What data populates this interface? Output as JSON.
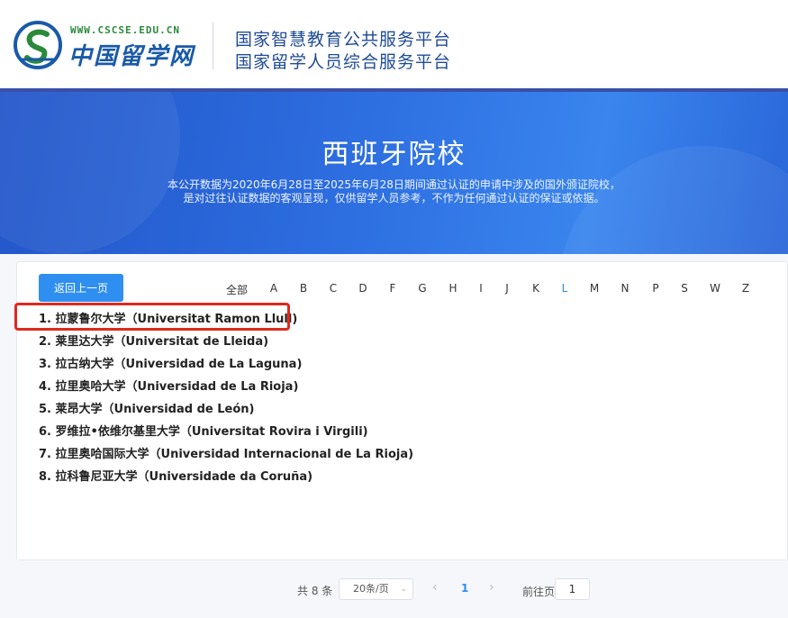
{
  "header": {
    "logo_url": "WWW.CSCSE.EDU.CN",
    "logo_name": "中国留学网",
    "platform_line1": "国家智慧教育公共服务平台",
    "platform_line2": "国家留学人员综合服务平台"
  },
  "banner": {
    "title": "西班牙院校",
    "desc_line1": "本公开数据为2020年6月28日至2025年6月28日期间通过认证的申请中涉及的国外颁证院校，",
    "desc_line2": "是对过往认证数据的客观呈现，仅供留学人员参考，不作为任何通过认证的保证或依据。"
  },
  "toolbar": {
    "back_label": "返回上一页"
  },
  "letters": [
    "全部",
    "A",
    "B",
    "C",
    "D",
    "F",
    "G",
    "H",
    "I",
    "J",
    "K",
    "L",
    "M",
    "N",
    "P",
    "S",
    "W",
    "Z"
  ],
  "active_letter": "L",
  "schools": [
    "1. 拉蒙鲁尔大学（Universitat Ramon Llull)",
    "2. 莱里达大学（Universitat de Lleida)",
    "3. 拉古纳大学（Universidad de La Laguna)",
    "4. 拉里奥哈大学（Universidad de La Rioja)",
    "5. 莱昂大学（Universidad de León)",
    "6. 罗维拉•依维尔基里大学（Universitat Rovira i Virgili)",
    "7. 拉里奥哈国际大学（Universidad Internacional de La Rioja)",
    "8. 拉科鲁尼亚大学（Universidade da Coruña)"
  ],
  "pagination": {
    "total": "共 8 条",
    "page_size": "20条/页",
    "current_page": "1",
    "goto_label": "前往页",
    "goto_value": "1"
  },
  "colors": {
    "accent": "#2f8ff0",
    "highlight": "#e0281e",
    "banner": "#2d6ee0"
  }
}
